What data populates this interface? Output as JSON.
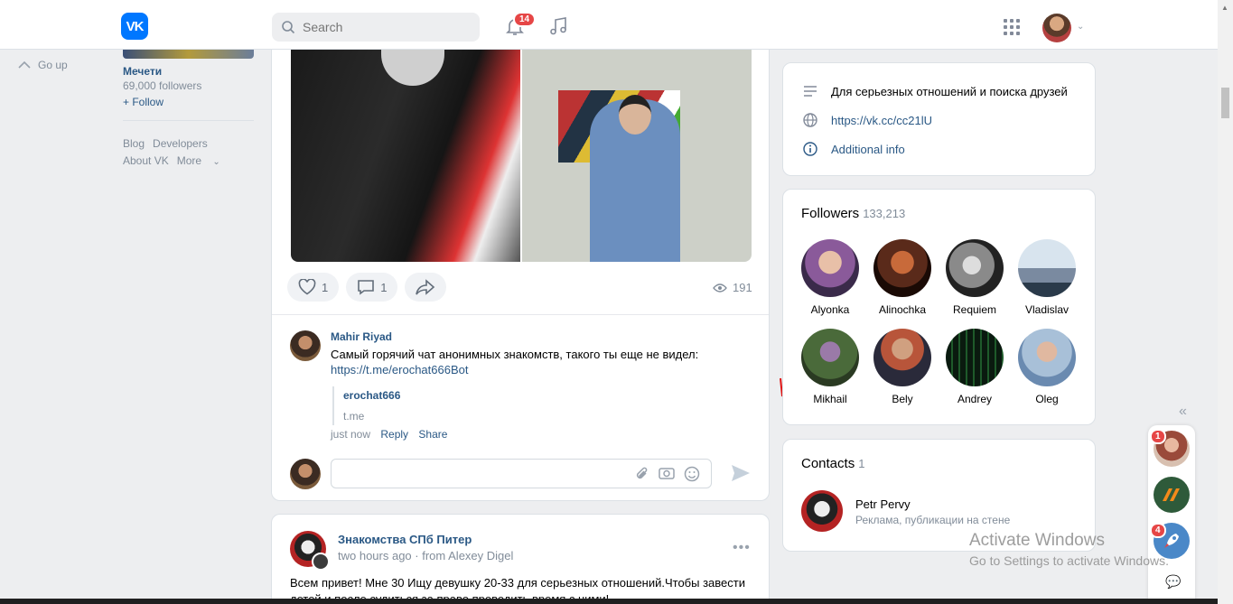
{
  "header": {
    "logo": "VK",
    "search_placeholder": "Search",
    "notifications_count": "14"
  },
  "left": {
    "go_up": "Go up",
    "group_name": "Мечети",
    "group_followers": "69,000 followers",
    "follow": "+ Follow",
    "footer": {
      "blog": "Blog",
      "developers": "Developers",
      "about": "About VK",
      "more": "More"
    }
  },
  "post": {
    "likes": "1",
    "comments": "1",
    "views": "191",
    "comment": {
      "author": "Mahir Riyad",
      "text": "Самый горячий чат анонимных знакомств, такого ты еще не видел:",
      "link": "https://t.me/erochat666Bot",
      "snippet_title": "erochat666",
      "snippet_domain": "t.me",
      "time": "just now",
      "reply": "Reply",
      "share": "Share"
    }
  },
  "post2": {
    "author": "Знакомства СПб Питер",
    "time": "two hours ago",
    "from": "from Alexey Digel",
    "text": "Всем привет! Мне 30 Ищу девушку 20-33 для серьезных отношений.Чтобы завести детей и после судиться за право проводить время с ними!"
  },
  "info": {
    "description": "Для серьезных отношений и поиска друзей",
    "url": "https://vk.cc/cc21lU",
    "additional": "Additional info"
  },
  "followers": {
    "title": "Followers",
    "count": "133,213",
    "list": [
      {
        "name": "Alyonka",
        "color": "#8a5a9a"
      },
      {
        "name": "Alinochka",
        "color": "#5a2a1a"
      },
      {
        "name": "Requiem",
        "color": "#8a8a8a"
      },
      {
        "name": "Vladislav",
        "color": "#7a8aa0"
      },
      {
        "name": "Mikhail",
        "color": "#4a6a3a"
      },
      {
        "name": "Bely",
        "color": "#b8553a"
      },
      {
        "name": "Andrey",
        "color": "#0a2a1a"
      },
      {
        "name": "Oleg",
        "color": "#a8c0d8"
      }
    ]
  },
  "contacts": {
    "title": "Contacts",
    "count": "1",
    "name": "Petr Pervy",
    "desc": "Реклама, публикации на стене"
  },
  "chats": {
    "badge1": "1",
    "badge2": "4"
  },
  "watermark": {
    "line1": "Activate Windows",
    "line2": "Go to Settings to activate Windows."
  }
}
